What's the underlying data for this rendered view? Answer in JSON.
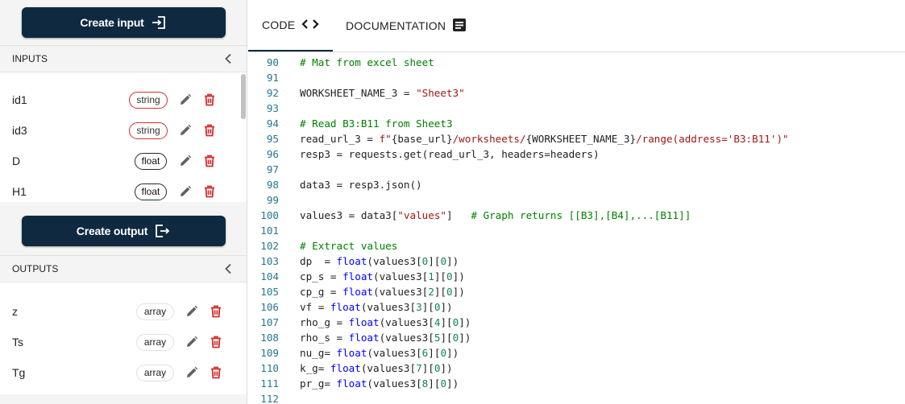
{
  "sidebar": {
    "create_input_label": "Create input",
    "inputs_title": "INPUTS",
    "inputs": [
      {
        "name": "id1",
        "type": "string",
        "style": "red"
      },
      {
        "name": "id3",
        "type": "string",
        "style": "red"
      },
      {
        "name": "D",
        "type": "float",
        "style": "dark"
      },
      {
        "name": "H1",
        "type": "float",
        "style": "dark"
      }
    ],
    "create_output_label": "Create output",
    "outputs_title": "OUTPUTS",
    "outputs": [
      {
        "name": "z",
        "type": "array"
      },
      {
        "name": "Ts",
        "type": "array"
      },
      {
        "name": "Tg",
        "type": "array"
      }
    ]
  },
  "tabs": {
    "code_label": "CODE",
    "docs_label": "DOCUMENTATION"
  },
  "colors": {
    "brand": "#0f2940",
    "danger": "#d32f2f",
    "comment": "#008000",
    "string": "#a31515",
    "function": "#0000ff",
    "number": "#098658",
    "line_number": "#237893"
  },
  "code_lines": [
    {
      "n": "90",
      "t": [
        [
          "# Mat from excel sheet",
          "comment"
        ]
      ]
    },
    {
      "n": "91",
      "t": []
    },
    {
      "n": "92",
      "t": [
        [
          "WORKSHEET_NAME_3 = ",
          "plain"
        ],
        [
          "\"Sheet3\"",
          "string"
        ]
      ]
    },
    {
      "n": "93",
      "t": []
    },
    {
      "n": "94",
      "t": [
        [
          "# Read B3:B11 from Sheet3",
          "comment"
        ]
      ]
    },
    {
      "n": "95",
      "t": [
        [
          "read_url_3 = ",
          "plain"
        ],
        [
          "f\"",
          "string"
        ],
        [
          "{base_url}",
          "plain"
        ],
        [
          "/worksheets/",
          "string"
        ],
        [
          "{WORKSHEET_NAME_3}",
          "plain"
        ],
        [
          "/range(address='B3:B11')\"",
          "string"
        ]
      ]
    },
    {
      "n": "96",
      "t": [
        [
          "resp3 = requests.get(read_url_3, headers=headers)",
          "plain"
        ]
      ]
    },
    {
      "n": "97",
      "t": []
    },
    {
      "n": "98",
      "t": [
        [
          "data3 = resp3.json()",
          "plain"
        ]
      ]
    },
    {
      "n": "99",
      "t": []
    },
    {
      "n": "100",
      "t": [
        [
          "values3 = data3[",
          "plain"
        ],
        [
          "\"values\"",
          "string"
        ],
        [
          "]   ",
          "plain"
        ],
        [
          "# Graph returns [[B3],[B4],...[B11]]",
          "comment"
        ]
      ]
    },
    {
      "n": "101",
      "t": []
    },
    {
      "n": "102",
      "t": [
        [
          "# Extract values",
          "comment"
        ]
      ]
    },
    {
      "n": "103",
      "t": [
        [
          "dp  = ",
          "plain"
        ],
        [
          "float",
          "func"
        ],
        [
          "(values3[",
          "plain"
        ],
        [
          "0",
          "num"
        ],
        [
          "][",
          "plain"
        ],
        [
          "0",
          "num"
        ],
        [
          "])",
          "plain"
        ]
      ]
    },
    {
      "n": "104",
      "t": [
        [
          "cp_s = ",
          "plain"
        ],
        [
          "float",
          "func"
        ],
        [
          "(values3[",
          "plain"
        ],
        [
          "1",
          "num"
        ],
        [
          "][",
          "plain"
        ],
        [
          "0",
          "num"
        ],
        [
          "])",
          "plain"
        ]
      ]
    },
    {
      "n": "105",
      "t": [
        [
          "cp_g = ",
          "plain"
        ],
        [
          "float",
          "func"
        ],
        [
          "(values3[",
          "plain"
        ],
        [
          "2",
          "num"
        ],
        [
          "][",
          "plain"
        ],
        [
          "0",
          "num"
        ],
        [
          "])",
          "plain"
        ]
      ]
    },
    {
      "n": "106",
      "t": [
        [
          "vf = ",
          "plain"
        ],
        [
          "float",
          "func"
        ],
        [
          "(values3[",
          "plain"
        ],
        [
          "3",
          "num"
        ],
        [
          "][",
          "plain"
        ],
        [
          "0",
          "num"
        ],
        [
          "])",
          "plain"
        ]
      ]
    },
    {
      "n": "107",
      "t": [
        [
          "rho_g = ",
          "plain"
        ],
        [
          "float",
          "func"
        ],
        [
          "(values3[",
          "plain"
        ],
        [
          "4",
          "num"
        ],
        [
          "][",
          "plain"
        ],
        [
          "0",
          "num"
        ],
        [
          "])",
          "plain"
        ]
      ]
    },
    {
      "n": "108",
      "t": [
        [
          "rho_s = ",
          "plain"
        ],
        [
          "float",
          "func"
        ],
        [
          "(values3[",
          "plain"
        ],
        [
          "5",
          "num"
        ],
        [
          "][",
          "plain"
        ],
        [
          "0",
          "num"
        ],
        [
          "])",
          "plain"
        ]
      ]
    },
    {
      "n": "109",
      "t": [
        [
          "nu_g= ",
          "plain"
        ],
        [
          "float",
          "func"
        ],
        [
          "(values3[",
          "plain"
        ],
        [
          "6",
          "num"
        ],
        [
          "][",
          "plain"
        ],
        [
          "0",
          "num"
        ],
        [
          "])",
          "plain"
        ]
      ]
    },
    {
      "n": "110",
      "t": [
        [
          "k_g= ",
          "plain"
        ],
        [
          "float",
          "func"
        ],
        [
          "(values3[",
          "plain"
        ],
        [
          "7",
          "num"
        ],
        [
          "][",
          "plain"
        ],
        [
          "0",
          "num"
        ],
        [
          "])",
          "plain"
        ]
      ]
    },
    {
      "n": "111",
      "t": [
        [
          "pr_g= ",
          "plain"
        ],
        [
          "float",
          "func"
        ],
        [
          "(values3[",
          "plain"
        ],
        [
          "8",
          "num"
        ],
        [
          "][",
          "plain"
        ],
        [
          "0",
          "num"
        ],
        [
          "])",
          "plain"
        ]
      ]
    },
    {
      "n": "112",
      "t": []
    }
  ]
}
